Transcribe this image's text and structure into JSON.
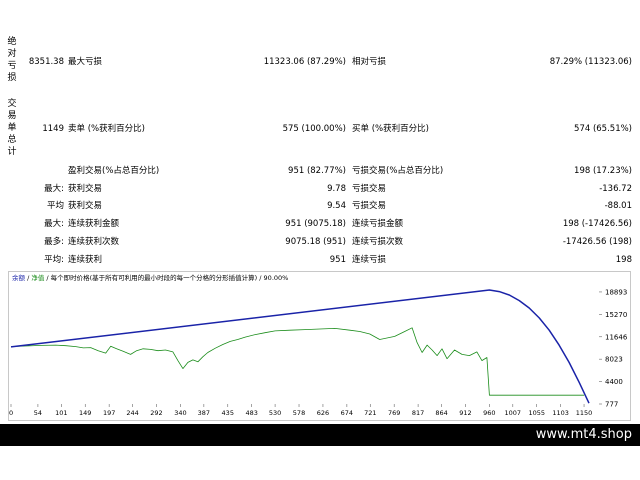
{
  "report": {
    "drawdown_group_label": "绝对亏损",
    "trades_group_label": "交易单总计",
    "abs_drawdown_value": "8351.38",
    "max_drawdown_label": "最大亏损",
    "max_drawdown_value": "11323.06 (87.29%)",
    "rel_drawdown_label": "相对亏损",
    "rel_drawdown_value": "87.29% (11323.06)",
    "total_trades_value": "1149",
    "short_label": "卖单 (%获利百分比)",
    "short_value": "575 (100.00%)",
    "long_label": "买单 (%获利百分比)",
    "long_value": "574 (65.51%)",
    "profit_trades_label": "盈利交易(%占总百分比)",
    "profit_trades_value": "951 (82.77%)",
    "loss_trades_label": "亏损交易(%占总百分比)",
    "loss_trades_value": "198 (17.23%)",
    "rows": [
      {
        "prefix": "最大:",
        "l_label": "获利交易",
        "l_value": "9.78",
        "r_label": "亏损交易",
        "r_value": "-136.72"
      },
      {
        "prefix": "平均",
        "l_label": "获利交易",
        "l_value": "9.54",
        "r_label": "亏损交易",
        "r_value": "-88.01"
      },
      {
        "prefix": "最大:",
        "l_label": "连续获利金额",
        "l_value": "951 (9075.18)",
        "r_label": "连续亏损金额",
        "r_value": "198 (-17426.56)"
      },
      {
        "prefix": "最多:",
        "l_label": "连续获利次数",
        "l_value": "9075.18 (951)",
        "r_label": "连续亏损次数",
        "r_value": "-17426.56 (198)"
      },
      {
        "prefix": "平均:",
        "l_label": "连续获利",
        "l_value": "951",
        "r_label": "连续亏损",
        "r_value": "198"
      }
    ]
  },
  "chart_legend": {
    "balance": "余额",
    "sep1": " / ",
    "equity": "净值",
    "rest": " / 每个即时价格(基于所有可利用的最小时段的每一个分格的分形插值计算) / 90.00%"
  },
  "colors": {
    "balance": "#1a23a8",
    "equity": "#1a8c1a",
    "footer_bg": "#000000"
  },
  "chart_data": {
    "type": "line",
    "x_ticks": [
      "0",
      "54",
      "101",
      "149",
      "197",
      "244",
      "292",
      "340",
      "387",
      "435",
      "483",
      "530",
      "578",
      "626",
      "674",
      "721",
      "769",
      "817",
      "864",
      "912",
      "960",
      "1007",
      "1055",
      "1103",
      "1150"
    ],
    "y_ticks": [
      "18893",
      "15270",
      "11646",
      "8023",
      "4400",
      "777"
    ],
    "ylim": [
      777,
      20500
    ],
    "xlim": [
      0,
      1180
    ],
    "series": [
      {
        "name": "余额",
        "x": [
          0,
          960,
          980,
          1000,
          1020,
          1040,
          1060,
          1080,
          1100,
          1120,
          1140,
          1160
        ],
        "values": [
          10000,
          19200,
          18950,
          18400,
          17500,
          16300,
          14700,
          12700,
          10300,
          7500,
          4300,
          900
        ]
      },
      {
        "name": "净值",
        "x": [
          0,
          30,
          60,
          90,
          110,
          130,
          145,
          160,
          175,
          190,
          200,
          212,
          225,
          240,
          252,
          265,
          280,
          295,
          310,
          325,
          335,
          345,
          355,
          365,
          375,
          385,
          395,
          410,
          425,
          440,
          455,
          470,
          490,
          510,
          530,
          560,
          590,
          620,
          650,
          680,
          700,
          720,
          740,
          770,
          790,
          805,
          815,
          825,
          835,
          845,
          855,
          865,
          875,
          890,
          905,
          920,
          935,
          945,
          955,
          960,
          970,
          1000,
          1050,
          1100,
          1150
        ],
        "values": [
          10050,
          10150,
          10250,
          10300,
          10200,
          10050,
          9850,
          9900,
          9400,
          9000,
          10100,
          9700,
          9300,
          8800,
          9400,
          9700,
          9600,
          9400,
          9500,
          9200,
          7800,
          6500,
          7500,
          7900,
          7600,
          8400,
          9100,
          9800,
          10400,
          10900,
          11200,
          11600,
          12000,
          12300,
          12600,
          12700,
          12800,
          12900,
          13000,
          12700,
          12500,
          12100,
          11200,
          11700,
          12500,
          13100,
          10700,
          9100,
          10300,
          9500,
          8600,
          9700,
          8100,
          9500,
          8800,
          8600,
          9200,
          7800,
          8300,
          2200,
          2200,
          2200,
          2200,
          2200,
          2200
        ]
      }
    ]
  },
  "footer": {
    "text": "www.mt4.shop"
  }
}
